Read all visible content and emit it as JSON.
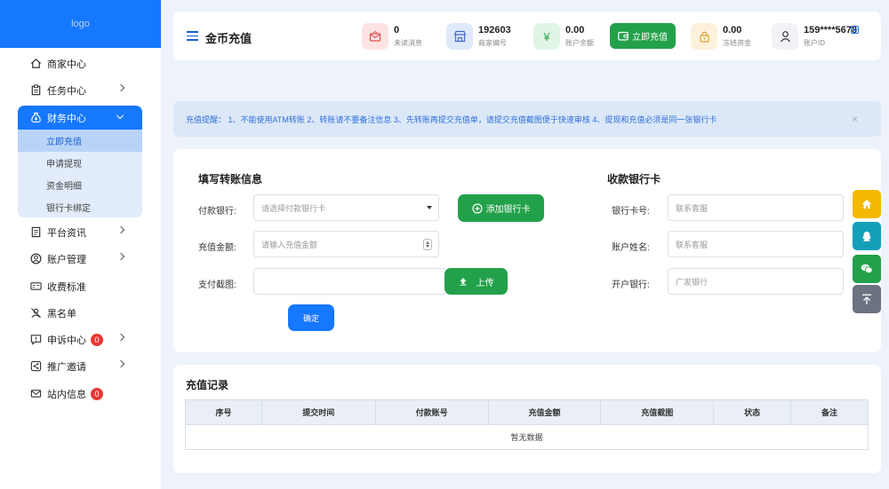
{
  "sidebar": {
    "logo": "logo",
    "items": [
      {
        "label": "商家中心",
        "icon": "home-icon"
      },
      {
        "label": "任务中心",
        "icon": "clipboard-icon"
      },
      {
        "label": "财务中心",
        "icon": "money-bag-icon"
      },
      {
        "label": "平台资讯",
        "icon": "document-icon"
      },
      {
        "label": "账户管理",
        "icon": "user-circle-icon"
      },
      {
        "label": "收费标准",
        "icon": "price-tag-icon"
      },
      {
        "label": "黑名单",
        "icon": "user-blocked-icon"
      },
      {
        "label": "申诉中心",
        "icon": "alert-icon",
        "badge": "0"
      },
      {
        "label": "推广邀请",
        "icon": "share-icon"
      },
      {
        "label": "站内信息",
        "icon": "mail-icon",
        "badge": "0"
      }
    ],
    "finance_sub": [
      "立即充值",
      "申请提现",
      "资金明细",
      "银行卡绑定"
    ]
  },
  "header": {
    "title": "金币充值",
    "stats": [
      {
        "value": "0",
        "label": "未读消息"
      },
      {
        "value": "192603",
        "label": "商家编号"
      },
      {
        "value": "0.00",
        "label": "账户余额"
      },
      {
        "value": "0.00",
        "label": "冻结资金"
      },
      {
        "value": "159****5678",
        "label": "账户ID"
      }
    ],
    "recharge_label": "立即充值",
    "colors": {
      "accent": "#1677ff",
      "green": "#23a14a"
    }
  },
  "notice": {
    "text": "充值提醒： 1、不能使用ATM转账 2、转账请不要备注信息 3、先转账再提交充值单，请提交充值截图便于快速审核 4、提现和充值必须是同一张银行卡",
    "close": "×"
  },
  "form": {
    "title": "填写转账信息",
    "bank_label": "付款银行:",
    "bank_placeholder": "请选择付款银行卡",
    "add_bank_label": "添加银行卡",
    "amount_label": "充值金额:",
    "amount_placeholder": "请输入充值金额",
    "screenshot_label": "支付截图:",
    "upload_label": "上传",
    "confirm_label": "确定"
  },
  "receive": {
    "title": "收款银行卡",
    "card_label": "银行卡号:",
    "card_value": "联系客服",
    "name_label": "账户姓名:",
    "name_value": "联系客服",
    "bank_label": "开户银行:",
    "bank_value": "广发银行"
  },
  "records": {
    "title": "充值记录",
    "columns": [
      "序号",
      "提交时间",
      "付款账号",
      "充值金额",
      "充值截图",
      "状态",
      "备注"
    ],
    "empty": "暂无数据"
  }
}
